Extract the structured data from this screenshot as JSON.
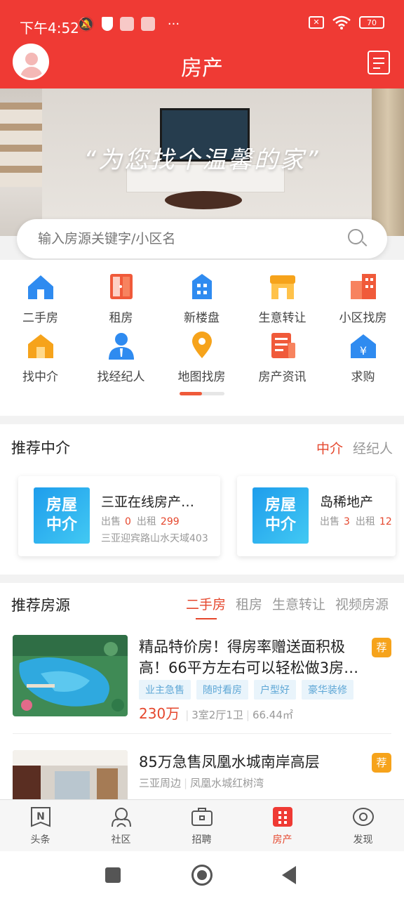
{
  "status_bar": {
    "time": "下午4:52",
    "battery": "70",
    "icons": [
      "mute-bell-icon",
      "shield-icon",
      "app-square-icon",
      "app-square-icon",
      "more-dots-icon",
      "no-sim-icon",
      "wifi-icon",
      "battery-icon"
    ],
    "more": "···"
  },
  "app_bar": {
    "title": "房产",
    "left_icon": "avatar",
    "right_icon": "edit-note-icon"
  },
  "banner": {
    "slogan": "“为您找个温馨的家”"
  },
  "search": {
    "placeholder": "输入房源关键字/小区名"
  },
  "categories": [
    {
      "label": "二手房",
      "icon": "house-icon",
      "color": "#2f8bf0"
    },
    {
      "label": "租房",
      "icon": "door-icon",
      "color": "#f05a3a"
    },
    {
      "label": "新楼盘",
      "icon": "building-icon",
      "color": "#2f8bf0"
    },
    {
      "label": "生意转让",
      "icon": "shop-icon",
      "color": "#f6a31b"
    },
    {
      "label": "小区找房",
      "icon": "apartments-icon",
      "color": "#f05a3a"
    },
    {
      "label": "找中介",
      "icon": "home-search-icon",
      "color": "#f6a31b"
    },
    {
      "label": "找经纪人",
      "icon": "agent-icon",
      "color": "#2f8bf0"
    },
    {
      "label": "地图找房",
      "icon": "map-pin-icon",
      "color": "#f6a31b"
    },
    {
      "label": "房产资讯",
      "icon": "news-icon",
      "color": "#f05a3a"
    },
    {
      "label": "求购",
      "icon": "yuan-house-icon",
      "color": "#2f8bf0"
    }
  ],
  "agencies": {
    "title": "推荐中介",
    "tabs": [
      "中介",
      "经纪人"
    ],
    "logo_text": [
      "房屋",
      "中介"
    ],
    "sale_label": "出售",
    "rent_label": "出租",
    "items": [
      {
        "name": "三亚在线房产…",
        "sale": "0",
        "rent": "299",
        "address": "三亚迎宾路山水天域403"
      },
      {
        "name": "岛稀地产",
        "sale": "3",
        "rent": "12",
        "address": ""
      }
    ]
  },
  "listings": {
    "title": "推荐房源",
    "tabs": [
      "二手房",
      "租房",
      "生意转让",
      "视频房源"
    ],
    "badge": "荐",
    "items": [
      {
        "title": "精品特价房！得房率赠送面积极高！66平方左右可以轻松做3房…",
        "tags": [
          "业主急售",
          "随时看房",
          "户型好",
          "豪华装修"
        ],
        "price": "230万",
        "layout": "3室2厅1卫",
        "area": "66.44㎡"
      },
      {
        "title": "85万急售凤凰水城南岸高层",
        "location": "三亚周边",
        "community": "凤凰水城红树湾"
      }
    ]
  },
  "tab_bar": [
    {
      "label": "头条",
      "icon": "headline-icon"
    },
    {
      "label": "社区",
      "icon": "community-icon"
    },
    {
      "label": "招聘",
      "icon": "briefcase-icon"
    },
    {
      "label": "房产",
      "icon": "grid-building-icon",
      "active": true
    },
    {
      "label": "发现",
      "icon": "eye-icon"
    }
  ],
  "colors": {
    "brand_red": "#ef3a34",
    "accent_orange": "#e5472d",
    "badge_yellow": "#f6a31b",
    "tag_blue": "#5ea7d6"
  }
}
